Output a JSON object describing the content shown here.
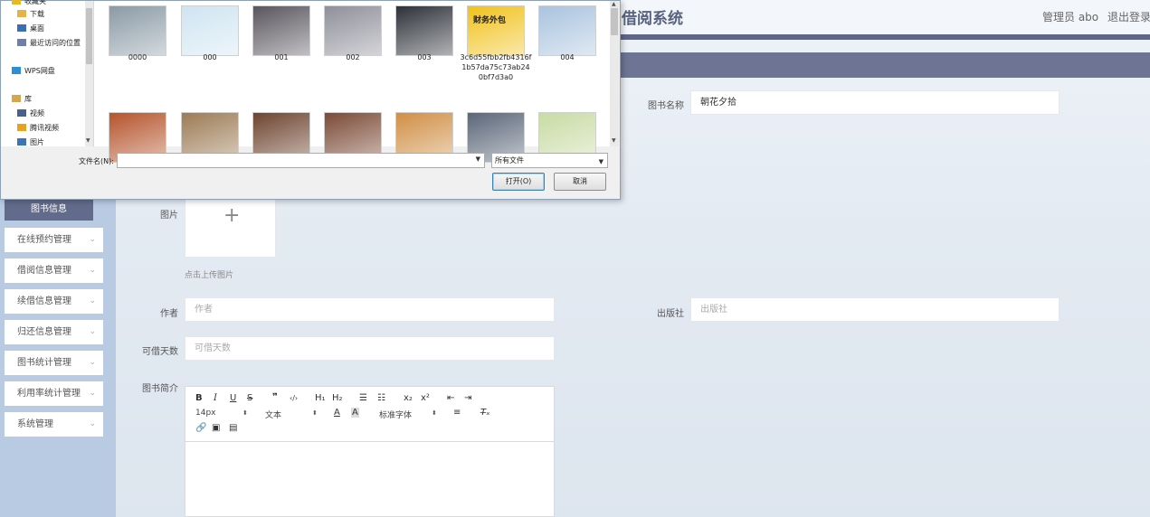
{
  "header": {
    "system_title": "借阅系统",
    "admin_label": "管理员 abo",
    "logout_label": "退出登录"
  },
  "sidebar": {
    "active_item": "图书信息",
    "items": [
      {
        "label": "在线预约管理"
      },
      {
        "label": "借阅信息管理"
      },
      {
        "label": "续借信息管理"
      },
      {
        "label": "归还信息管理"
      },
      {
        "label": "图书统计管理"
      },
      {
        "label": "利用率统计管理"
      },
      {
        "label": "系统管理"
      }
    ]
  },
  "form": {
    "book_name_label": "图书名称",
    "book_name_value": "朝花夕拾",
    "image_label": "图片",
    "upload_hint": "点击上传图片",
    "author_label": "作者",
    "author_placeholder": "作者",
    "publisher_label": "出版社",
    "publisher_placeholder": "出版社",
    "borrow_days_label": "可借天数",
    "borrow_days_placeholder": "可借天数",
    "intro_label": "图书简介"
  },
  "editor": {
    "font_size": "14px",
    "block_type": "文本",
    "font_family": "标准字体"
  },
  "file_dialog": {
    "nav_items": [
      {
        "label": "收藏夹",
        "icon": "star-icon"
      },
      {
        "label": "下载",
        "icon": "download-icon"
      },
      {
        "label": "桌面",
        "icon": "desktop-icon"
      },
      {
        "label": "最近访问的位置",
        "icon": "recent-icon"
      },
      {
        "label": "WPS网盘",
        "icon": "cloud-icon"
      },
      {
        "label": "库",
        "icon": "library-icon"
      },
      {
        "label": "视频",
        "icon": "video-icon"
      },
      {
        "label": "腾讯视频",
        "icon": "tencent-video-icon"
      },
      {
        "label": "图片",
        "icon": "picture-icon"
      }
    ],
    "files": [
      {
        "name": "0000",
        "color": "#8a9aa5"
      },
      {
        "name": "000",
        "color": "#cfe4f1"
      },
      {
        "name": "001",
        "color": "#59555d"
      },
      {
        "name": "002",
        "color": "#8e8f99"
      },
      {
        "name": "003",
        "color": "#2d3138"
      },
      {
        "name": "3c6d55fbb2fb4316f1b57da75c73ab240bf7d3a0",
        "color": "#f1c21b",
        "overlay_text": "财务外包"
      },
      {
        "name": "004",
        "color": "#a9c3de"
      },
      {
        "name": "",
        "color": "#b5542c"
      },
      {
        "name": "",
        "color": "#9c7b55"
      },
      {
        "name": "",
        "color": "#6e4430"
      },
      {
        "name": "",
        "color": "#7b4a36"
      },
      {
        "name": "",
        "color": "#d08f46"
      },
      {
        "name": "",
        "color": "#5a6678"
      },
      {
        "name": "",
        "color": "#c8dba4"
      }
    ],
    "filename_label": "文件名(N):",
    "filename_value": "",
    "filetype_value": "所有文件",
    "open_label": "打开(O)",
    "cancel_label": "取消"
  }
}
